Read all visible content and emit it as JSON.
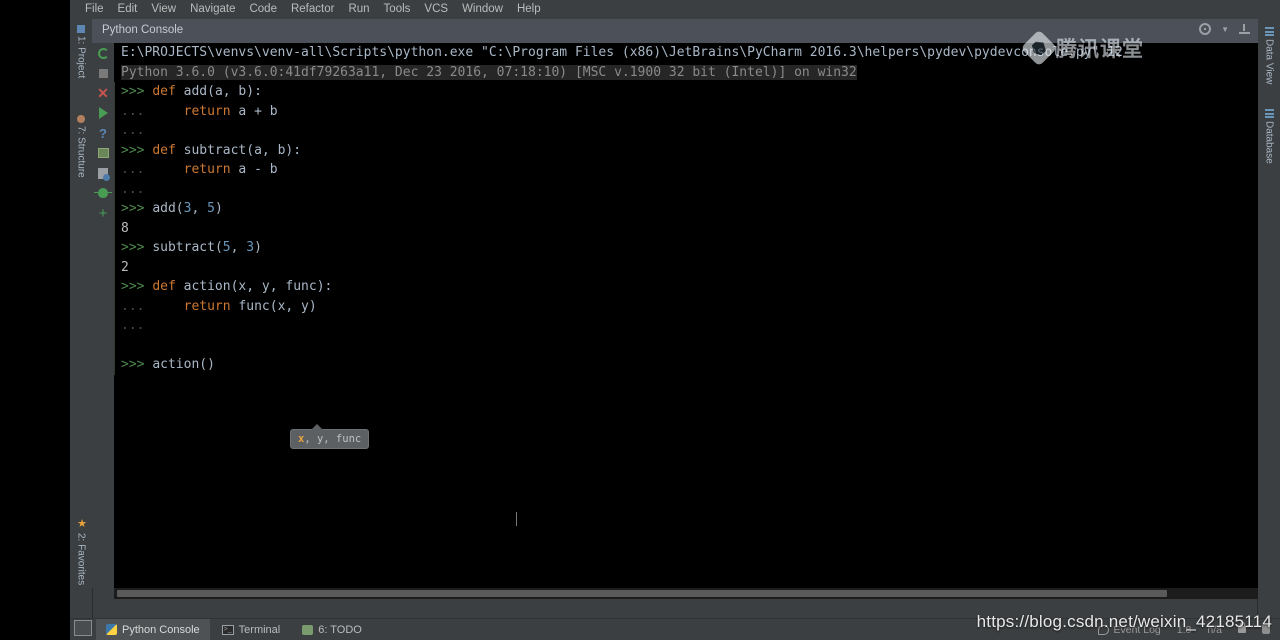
{
  "window": {
    "app": "PyCharm 2016.3",
    "panel_title": "Python Console"
  },
  "menubar": {
    "items": [
      {
        "label": "File"
      },
      {
        "label": "Edit"
      },
      {
        "label": "View"
      },
      {
        "label": "Navigate"
      },
      {
        "label": "Code"
      },
      {
        "label": "Refactor"
      },
      {
        "label": "Run"
      },
      {
        "label": "Tools"
      },
      {
        "label": "VCS"
      },
      {
        "label": "Window"
      },
      {
        "label": "Help"
      }
    ]
  },
  "left_tool_strip": {
    "tabs": [
      {
        "label": "1: Project",
        "icon": "project-icon"
      },
      {
        "label": "7: Structure",
        "icon": "structure-icon"
      },
      {
        "label": "2: Favorites",
        "icon": "star-icon"
      }
    ]
  },
  "right_tool_strip": {
    "tabs": [
      {
        "label": "Data View",
        "icon": "table-grid-icon"
      },
      {
        "label": "Database",
        "icon": "database-icon"
      }
    ]
  },
  "console_toolbar": {
    "buttons": [
      {
        "name": "rerun-icon",
        "title": "Rerun"
      },
      {
        "name": "stop-icon",
        "title": "Stop"
      },
      {
        "name": "close-icon",
        "title": "Close"
      },
      {
        "name": "run-icon",
        "title": "Execute"
      },
      {
        "name": "help-icon",
        "title": "Help"
      },
      {
        "name": "show-variables-icon",
        "title": "Show Variables"
      },
      {
        "name": "command-history-icon",
        "title": "Command History"
      },
      {
        "name": "debug-icon",
        "title": "Attach Debugger"
      },
      {
        "name": "new-console-icon",
        "title": "New Console"
      }
    ]
  },
  "panel_controls": {
    "settings": "gear-icon",
    "minimize": "minimize-icon"
  },
  "console": {
    "startup": {
      "command": "E:\\PROJECTS\\venvs\\venv-all\\Scripts\\python.exe \"C:\\Program Files (x86)\\JetBrains\\PyCharm 2016.3\\helpers\\pydev\\pydevconsole.py\" 12",
      "version": "Python 3.6.0 (v3.6.0:41df79263a11, Dec 23 2016, 07:18:10) [MSC v.1900 32 bit (Intel)] on win32"
    },
    "lines": [
      {
        "type": "prompt",
        "prompt": ">>>",
        "code": "def add(a, b):"
      },
      {
        "type": "cont",
        "prompt": "...",
        "code": "    return a + b"
      },
      {
        "type": "cont",
        "prompt": "...",
        "code": ""
      },
      {
        "type": "prompt",
        "prompt": ">>>",
        "code": "def subtract(a, b):"
      },
      {
        "type": "cont",
        "prompt": "...",
        "code": "    return a - b"
      },
      {
        "type": "cont",
        "prompt": "...",
        "code": ""
      },
      {
        "type": "prompt",
        "prompt": ">>>",
        "code": "add(3, 5)"
      },
      {
        "type": "output",
        "prompt": "",
        "code": "8"
      },
      {
        "type": "prompt",
        "prompt": ">>>",
        "code": "subtract(5, 3)"
      },
      {
        "type": "output",
        "prompt": "",
        "code": "2"
      },
      {
        "type": "prompt",
        "prompt": ">>>",
        "code": "def action(x, y, func):"
      },
      {
        "type": "cont",
        "prompt": "...",
        "code": "    return func(x, y)"
      },
      {
        "type": "cont",
        "prompt": "...",
        "code": ""
      },
      {
        "type": "blank",
        "prompt": "",
        "code": ""
      },
      {
        "type": "prompt",
        "prompt": ">>>",
        "code": "action()"
      }
    ],
    "param_hint": {
      "current": "x",
      "rest": ", y, func"
    }
  },
  "status_bar": {
    "tabs": [
      {
        "label": "Python Console",
        "icon": "python-icon",
        "active": true
      },
      {
        "label": "Terminal",
        "icon": "terminal-icon",
        "active": false
      },
      {
        "label": "6: TODO",
        "icon": "todo-icon",
        "active": false
      }
    ],
    "event_log": "Event Log",
    "caret_position": "1:8",
    "encoding": "n/a"
  },
  "watermarks": {
    "brand": "腾讯课堂",
    "url": "https://blog.csdn.net/weixin_42185114"
  },
  "colors": {
    "ide_bg": "#3c3f41",
    "console_bg": "#000000",
    "prompt_green": "#4f8a4f",
    "keyword_orange": "#cc7832",
    "identifier": "#a9b7c6",
    "number_blue": "#6897bb",
    "tab_active": "#4b5059",
    "hint_bg": "#5c6063",
    "hint_current": "#e8a33d"
  }
}
